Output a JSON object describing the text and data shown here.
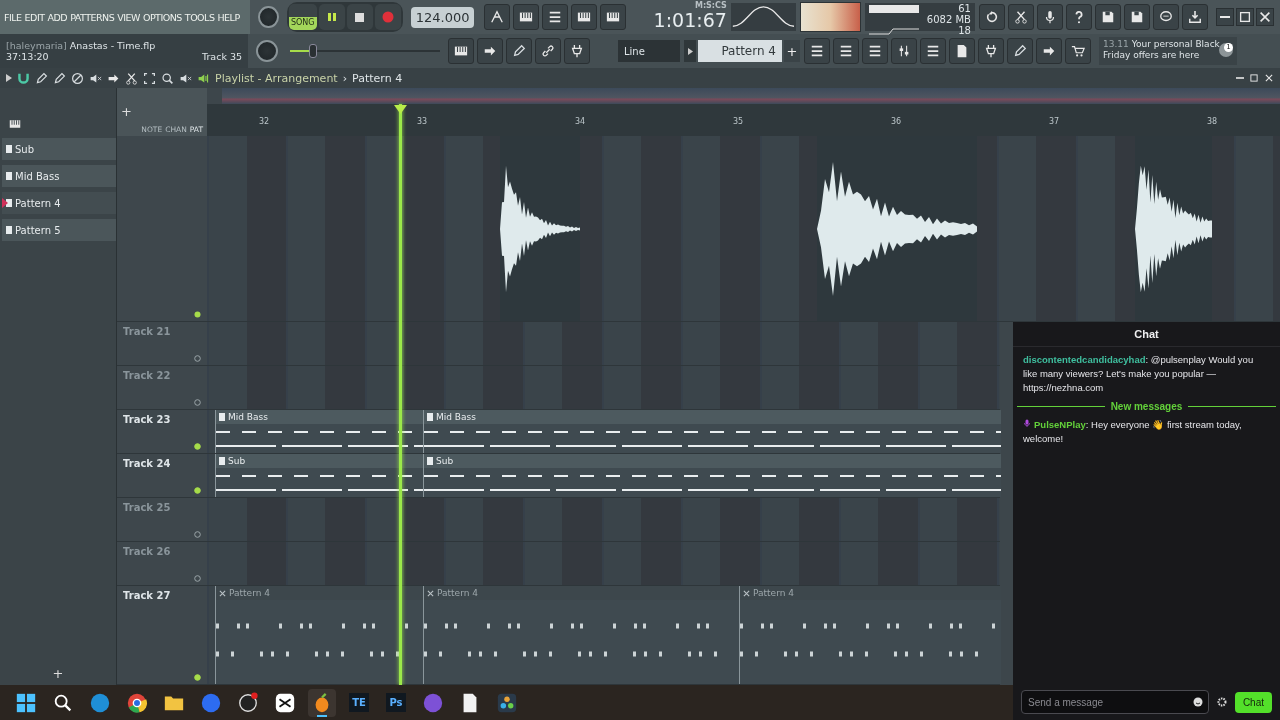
{
  "menu": [
    "FILE",
    "EDIT",
    "ADD",
    "PATTERNS",
    "VIEW",
    "OPTIONS",
    "TOOLS",
    "HELP"
  ],
  "project": {
    "user": "[haleymaria]",
    "file": "Anastas - Time.flp",
    "elapsed": "37:13:20",
    "track": "Track 35"
  },
  "transport": {
    "mode_label": "SONG",
    "song_mode": true,
    "playing": true
  },
  "tempo": "124.000",
  "time": {
    "value": "1:01:67",
    "unit": "M:S:CS"
  },
  "cpu": {
    "cpu": "61",
    "ram": "6082 MB",
    "polyphony": "18"
  },
  "main_volume": {
    "level": 0.15
  },
  "snap": "Line",
  "pattern_selector": {
    "value": "Pattern 4",
    "add": "+"
  },
  "news": {
    "date": "13.11",
    "text": "Your personal Black Friday offers are here",
    "badge": "1"
  },
  "playlist": {
    "title": "Playlist - Arrangement",
    "separator": "›",
    "pattern": "Pattern 4"
  },
  "picker": {
    "modes": [
      "NOTE",
      "CHAN",
      "PAT"
    ],
    "add": "+",
    "items": [
      {
        "name": "Sub",
        "selected": false
      },
      {
        "name": "Mid Bass",
        "selected": false
      },
      {
        "name": "Pattern 4",
        "selected": true
      },
      {
        "name": "Pattern 5",
        "selected": false
      }
    ]
  },
  "ruler": [
    "32",
    "33",
    "34",
    "35",
    "36",
    "37",
    "38"
  ],
  "tracks": [
    {
      "name": "Track 21"
    },
    {
      "name": "Track 22"
    },
    {
      "name": "Track 23",
      "clips": [
        {
          "kind": "bass",
          "label": "Mid Bass"
        },
        {
          "kind": "bass",
          "label": "Mid Bass"
        }
      ]
    },
    {
      "name": "Track 24",
      "clips": [
        {
          "kind": "bass",
          "label": "Sub"
        },
        {
          "kind": "bass",
          "label": "Sub"
        }
      ]
    },
    {
      "name": "Track 25"
    },
    {
      "name": "Track 26"
    },
    {
      "name": "Track 27",
      "clips": [
        {
          "kind": "drums",
          "label": "Pattern 4"
        },
        {
          "kind": "drums",
          "label": "Pattern 4"
        },
        {
          "kind": "drums",
          "label": "Pattern 4"
        }
      ]
    }
  ],
  "chat": {
    "title": "Chat",
    "messages": [
      {
        "user": "discontentedcandidacyhad",
        "color": "#3fbf9f",
        "badge": false,
        "text": ": @pulsenplay Would you like many viewers? Let's make you popular — https://nezhna.com"
      },
      {
        "divider": "New messages"
      },
      {
        "user": "PulseNPlay",
        "color": "#63d13a",
        "badge": true,
        "text": ": Hey everyone 👋 first stream today, welcome!"
      }
    ],
    "placeholder": "Send a message",
    "send": "Chat"
  },
  "taskbar": [
    {
      "kind": "start",
      "selected": false
    },
    {
      "kind": "search",
      "selected": false
    },
    {
      "kind": "edge",
      "selected": false
    },
    {
      "kind": "chrome",
      "selected": false
    },
    {
      "kind": "folder",
      "selected": false
    },
    {
      "kind": "zoom",
      "selected": false
    },
    {
      "kind": "obs",
      "selected": false
    },
    {
      "kind": "capcut",
      "selected": false
    },
    {
      "kind": "fl",
      "selected": true
    },
    {
      "kind": "text",
      "label": "TE",
      "selected": false
    },
    {
      "kind": "text",
      "label": "Ps",
      "selected": false
    },
    {
      "kind": "viber",
      "selected": false
    },
    {
      "kind": "file",
      "selected": false
    },
    {
      "kind": "resolve",
      "selected": false
    }
  ]
}
